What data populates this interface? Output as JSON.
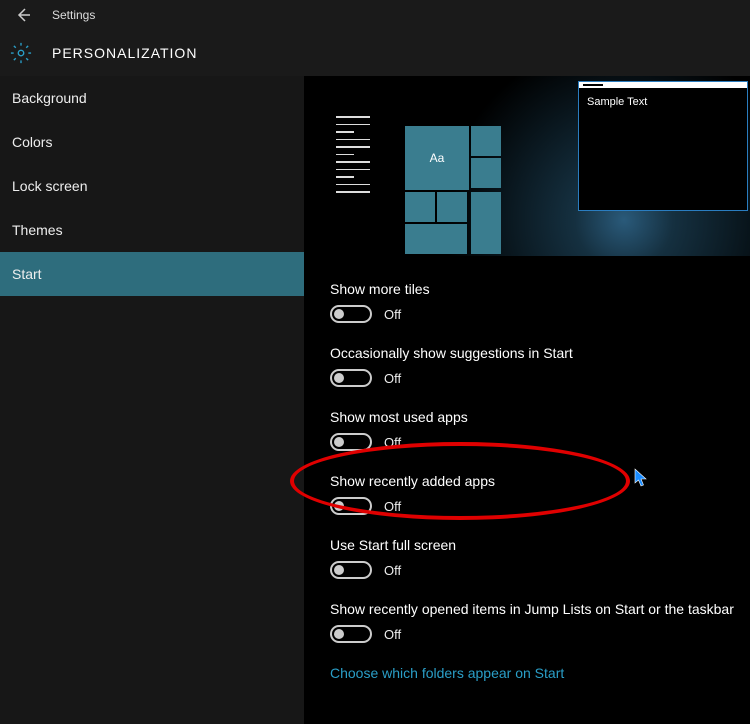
{
  "app": {
    "title": "Settings"
  },
  "header": {
    "title": "PERSONALIZATION"
  },
  "sidebar": {
    "items": [
      {
        "label": "Background",
        "active": false
      },
      {
        "label": "Colors",
        "active": false
      },
      {
        "label": "Lock screen",
        "active": false
      },
      {
        "label": "Themes",
        "active": false
      },
      {
        "label": "Start",
        "active": true
      }
    ]
  },
  "preview": {
    "tile_text": "Aa",
    "sample_window_text": "Sample Text"
  },
  "settings": [
    {
      "label": "Show more tiles",
      "value": "Off"
    },
    {
      "label": "Occasionally show suggestions in Start",
      "value": "Off"
    },
    {
      "label": "Show most used apps",
      "value": "Off"
    },
    {
      "label": "Show recently added apps",
      "value": "Off"
    },
    {
      "label": "Use Start full screen",
      "value": "Off"
    },
    {
      "label": "Show recently opened items in Jump Lists on Start or the taskbar",
      "value": "Off"
    }
  ],
  "link": {
    "choose_folders": "Choose which folders appear on Start"
  },
  "annotation": {
    "highlighted_setting_index": 1
  },
  "colors": {
    "accent": "#2e6d7d",
    "link": "#2a9ec7"
  }
}
